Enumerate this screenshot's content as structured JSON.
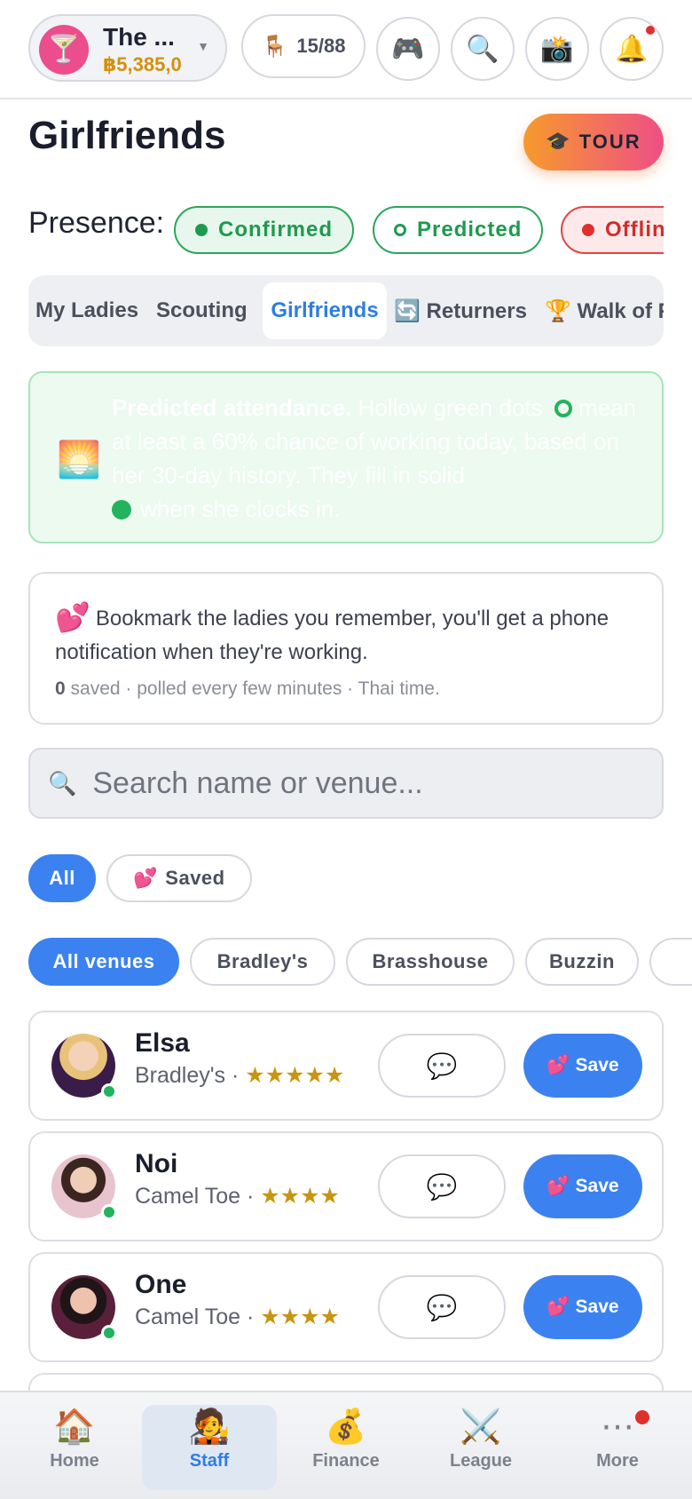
{
  "header": {
    "club_logo_glyph": "🍸",
    "club_name": "The ...",
    "club_money": "฿5,385,0",
    "seats_icon": "🪑",
    "seats": "15/88",
    "icons": [
      "gamepad-icon",
      "search-icon",
      "camera-icon",
      "bell-icon"
    ],
    "icon_glyphs": {
      "gamepad": "🎮",
      "search": "🔍",
      "camera": "📸",
      "bell": "🔔"
    }
  },
  "page": {
    "title": "Girlfriends",
    "tour_icon": "🎓",
    "tour_label": "TOUR"
  },
  "presence": {
    "label": "Presence:",
    "chips": [
      {
        "label": "Confirmed",
        "color": "#1e9a4f"
      },
      {
        "label": "Predicted",
        "color": "#1e9a4f"
      },
      {
        "label": "Offline",
        "color": "#d12d2d"
      }
    ]
  },
  "tabs": [
    {
      "label": "My Ladies"
    },
    {
      "label": "Scouting"
    },
    {
      "label": "Girlfriends"
    },
    {
      "label": "🔄 Returners"
    },
    {
      "label": "🏆 Walk of Fame"
    }
  ],
  "predicted_info": {
    "icon": "🌅",
    "bold": "Predicted attendance.",
    "text1": "Hollow green dots",
    "text2": "mean at least a 60% chance of working today, based on her 30-day history. They fill in solid",
    "text3": "when she clocks in."
  },
  "bookmark_info": {
    "icon": "💕",
    "text": "Bookmark the ladies you remember, you'll get a phone notification when they're working.",
    "saved_count": "0",
    "meta": "saved · polled every few minutes · Thai time."
  },
  "search": {
    "icon": "🔍",
    "placeholder": "Search name or venue..."
  },
  "filters": {
    "all": "All",
    "saved_icon": "💕",
    "saved": "Saved"
  },
  "venues": [
    "All venues",
    "Bradley's",
    "Brasshouse",
    "Buzzin",
    ""
  ],
  "staff": [
    {
      "name": "Elsa",
      "subtitle": "Bradley's · ",
      "stars": "★★★★★",
      "save_icon": "💕",
      "save_label": "Save",
      "chat_icon": "💬"
    },
    {
      "name": "Noi",
      "subtitle": "Camel Toe · ",
      "stars": "★★★★",
      "save_icon": "💕",
      "save_label": "Save",
      "chat_icon": "💬"
    },
    {
      "name": "One",
      "subtitle": "Camel Toe · ",
      "stars": "★★★★",
      "save_icon": "💕",
      "save_label": "Save",
      "chat_icon": "💬"
    }
  ],
  "bottom_nav": [
    {
      "label": "Home",
      "icon": "🏠"
    },
    {
      "label": "Staff",
      "icon": "🧑‍🎤"
    },
    {
      "label": "Finance",
      "icon": "💰"
    },
    {
      "label": "League",
      "icon": "⚔️"
    },
    {
      "label": "More",
      "icon": "⋯"
    }
  ],
  "colors": {
    "accent": "#3b82f0",
    "confirmed": "#1e9a4f",
    "offline": "#d12d2d",
    "money": "#d4900d",
    "stars": "#c89510"
  }
}
